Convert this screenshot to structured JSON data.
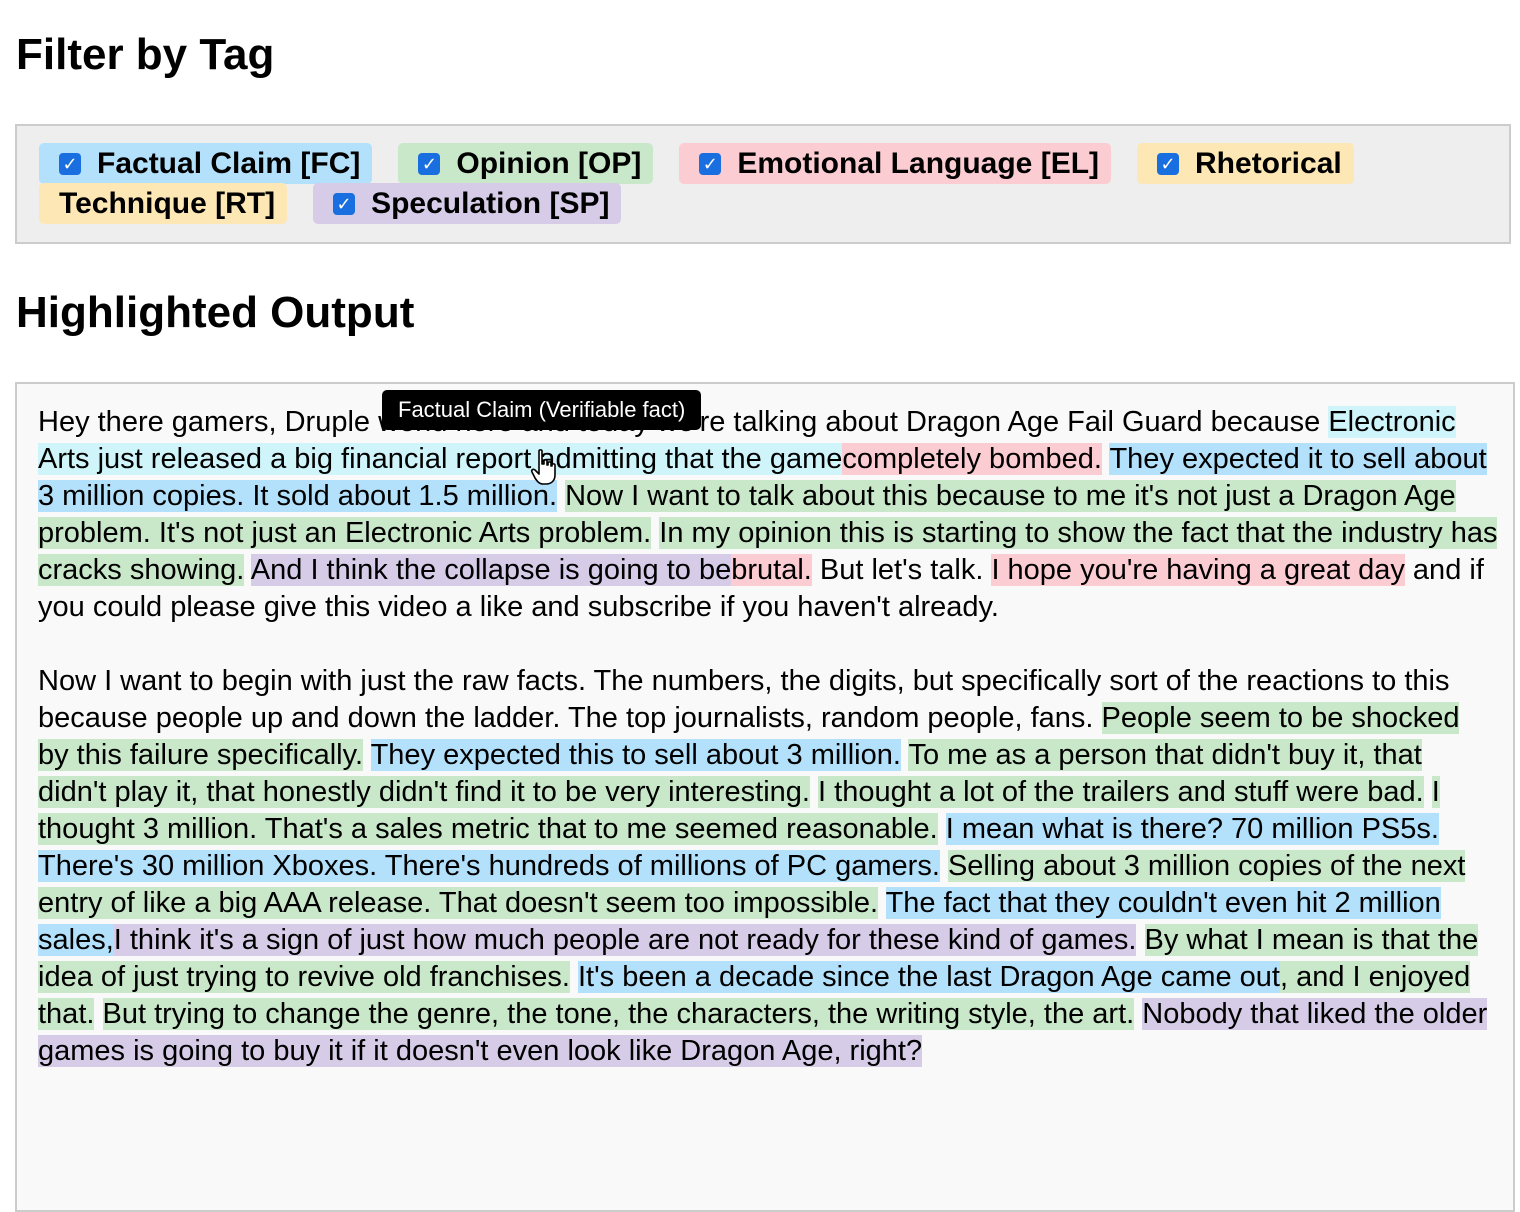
{
  "filter": {
    "heading": "Filter by Tag",
    "tags": [
      {
        "id": "fc",
        "label": "Factual Claim [FC]",
        "checked": true,
        "color": "#b3e0fb"
      },
      {
        "id": "op",
        "label": "Opinion [OP]",
        "checked": true,
        "color": "#c8e8c9"
      },
      {
        "id": "el",
        "label": "Emotional Language [EL]",
        "checked": true,
        "color": "#fbcdd2"
      },
      {
        "id": "rt",
        "label_part1": "Rhetorical",
        "label_part2": "Technique [RT]",
        "checked": true,
        "color": "#fde7b5"
      },
      {
        "id": "sp",
        "label": "Speculation [SP]",
        "checked": true,
        "color": "#d6cce8"
      }
    ]
  },
  "output": {
    "heading": "Highlighted Output",
    "tooltip": "Factual Claim (Verifiable fact)",
    "paragraphs": [
      [
        {
          "text": "Hey there gamers, Druple world here and today we're talking about Dragon Age Fail Guard because ",
          "tag": null
        },
        {
          "text": "Electronic Arts just released a big financial report admitting that the game",
          "tag": "FC-light"
        },
        {
          "text": "completely bombed.",
          "tag": "EL"
        },
        {
          "text": " ",
          "tag": null
        },
        {
          "text": "They expected it to sell about 3 million copies. It sold about 1.5 million.",
          "tag": "FC"
        },
        {
          "text": " ",
          "tag": null
        },
        {
          "text": "Now I want to talk about this because to me it's not just a Dragon Age problem. It's not just an Electronic Arts problem.",
          "tag": "OP"
        },
        {
          "text": " ",
          "tag": null
        },
        {
          "text": "In my opinion this is starting to show the fact that the industry has cracks showing.",
          "tag": "OP"
        },
        {
          "text": " ",
          "tag": null
        },
        {
          "text": "And I think the collapse is going to be",
          "tag": "SP"
        },
        {
          "text": "brutal.",
          "tag": "EL"
        },
        {
          "text": " But let's talk. ",
          "tag": null
        },
        {
          "text": "I hope you're having a great day",
          "tag": "EL"
        },
        {
          "text": " and if you could please give this video a like and subscribe if you haven't already.",
          "tag": null
        }
      ],
      [
        {
          "text": "Now I want to begin with just the raw facts. The numbers, the digits, but specifically sort of the reactions to this because people up and down the ladder. The top journalists, random people, fans. ",
          "tag": null
        },
        {
          "text": "People seem to be shocked by this failure specifically.",
          "tag": "OP"
        },
        {
          "text": " ",
          "tag": null
        },
        {
          "text": "They expected this to sell about 3 million.",
          "tag": "FC"
        },
        {
          "text": " ",
          "tag": null
        },
        {
          "text": "To me as a person that didn't buy it, that didn't play it, that honestly didn't find it to be very interesting.",
          "tag": "OP"
        },
        {
          "text": " ",
          "tag": null
        },
        {
          "text": "I thought a lot of the trailers and stuff were bad.",
          "tag": "OP"
        },
        {
          "text": " ",
          "tag": null
        },
        {
          "text": "I thought 3 million. That's a sales metric that to me seemed reasonable.",
          "tag": "OP"
        },
        {
          "text": " ",
          "tag": null
        },
        {
          "text": "I mean what is there? 70 million PS5s. There's 30 million Xboxes. There's hundreds of millions of PC gamers.",
          "tag": "FC"
        },
        {
          "text": " ",
          "tag": null
        },
        {
          "text": "Selling about 3 million copies of the next entry of like a big AAA release. That doesn't seem too impossible.",
          "tag": "OP"
        },
        {
          "text": " ",
          "tag": null
        },
        {
          "text": "The fact that they couldn't even hit 2 million sales,",
          "tag": "FC"
        },
        {
          "text": "I think it's a sign of just how much people are not ready for these kind of games.",
          "tag": "SP"
        },
        {
          "text": " ",
          "tag": null
        },
        {
          "text": "By what I mean is that the idea of just trying to revive old franchises.",
          "tag": "OP"
        },
        {
          "text": " ",
          "tag": null
        },
        {
          "text": "It's been a decade since the last Dragon Age came out",
          "tag": "FC"
        },
        {
          "text": ", and I enjoyed that.",
          "tag": "OP"
        },
        {
          "text": " ",
          "tag": null
        },
        {
          "text": "But trying to change the genre, the tone, the characters, the writing style, the art.",
          "tag": "OP"
        },
        {
          "text": " ",
          "tag": null
        },
        {
          "text": "Nobody that liked the older games is going to buy it if it doesn't even look like Dragon Age, right?",
          "tag": "SP"
        }
      ]
    ]
  }
}
